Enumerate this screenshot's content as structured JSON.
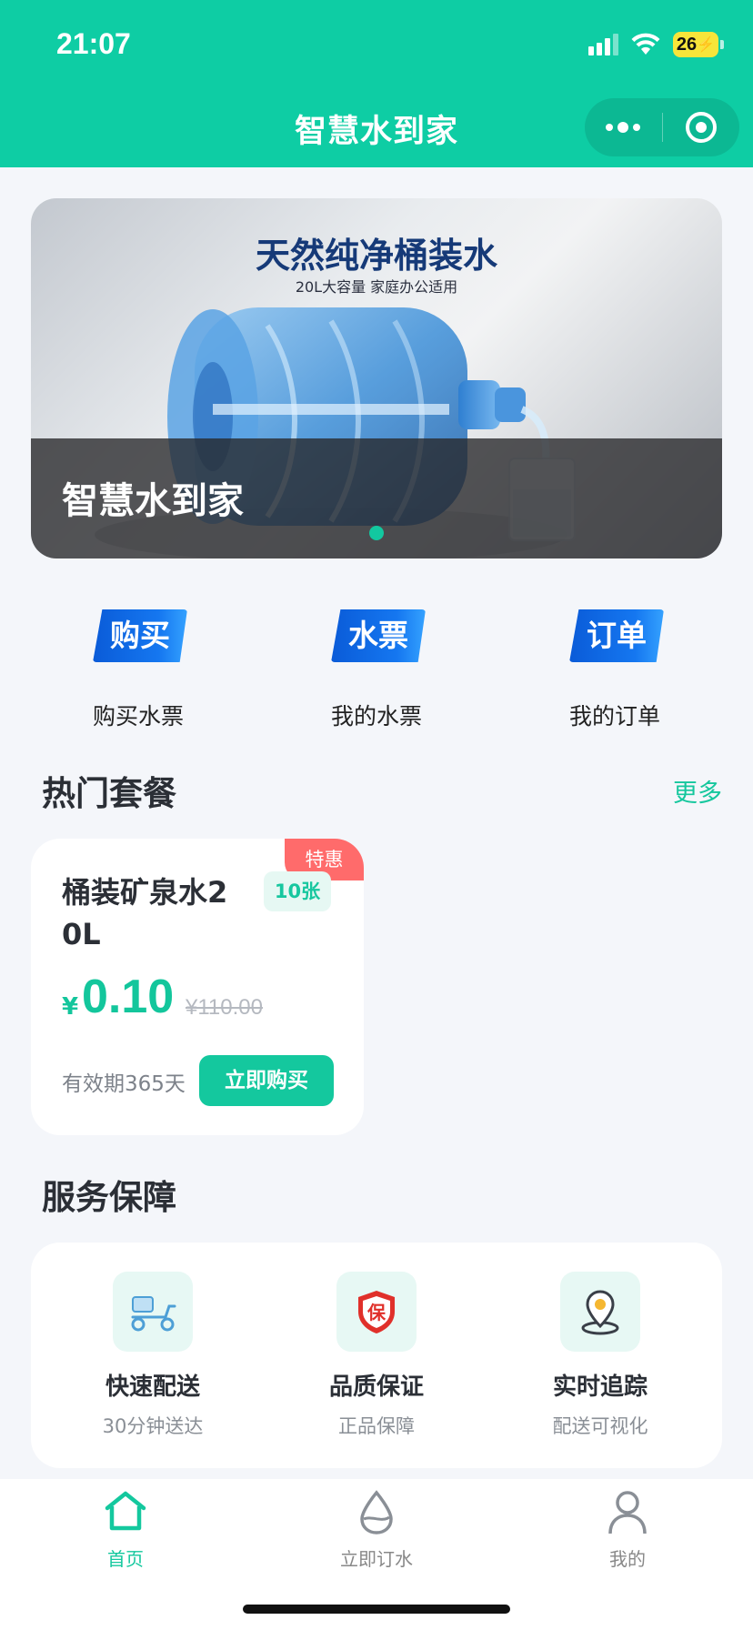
{
  "status_bar": {
    "time": "21:07",
    "battery": "26"
  },
  "nav": {
    "title": "智慧水到家"
  },
  "banner": {
    "headline": "天然纯净桶装水",
    "subline": "20L大容量 家庭办公适用",
    "caption": "智慧水到家"
  },
  "quick_entries": [
    {
      "tag": "购买",
      "label": "购买水票",
      "icon": "buy-tag-icon"
    },
    {
      "tag": "水票",
      "label": "我的水票",
      "icon": "ticket-tag-icon"
    },
    {
      "tag": "订单",
      "label": "我的订单",
      "icon": "order-tag-icon"
    }
  ],
  "hot": {
    "title": "热门套餐",
    "more": "更多",
    "card": {
      "ribbon": "特惠",
      "name": "桶装矿泉水20L",
      "qty": "10张",
      "currency": "¥",
      "price": "0.10",
      "original_price": "¥110.00",
      "validity": "有效期365天",
      "buy_label": "立即购买"
    }
  },
  "service": {
    "title": "服务保障",
    "items": [
      {
        "title": "快速配送",
        "sub": "30分钟送达",
        "icon": "scooter-icon"
      },
      {
        "title": "品质保证",
        "sub": "正品保障",
        "icon": "shield-bao-icon",
        "icon_text": "保"
      },
      {
        "title": "实时追踪",
        "sub": "配送可视化",
        "icon": "location-pin-icon"
      }
    ]
  },
  "tabbar": {
    "items": [
      {
        "label": "首页",
        "icon": "home-icon",
        "active": true
      },
      {
        "label": "立即订水",
        "icon": "water-drop-icon",
        "active": false
      },
      {
        "label": "我的",
        "icon": "user-icon",
        "active": false
      }
    ]
  },
  "colors": {
    "brand": "#0ecda4",
    "accent": "#14c89e",
    "ribbon": "#ff6b6b",
    "tag_blue": "#1577f0"
  }
}
